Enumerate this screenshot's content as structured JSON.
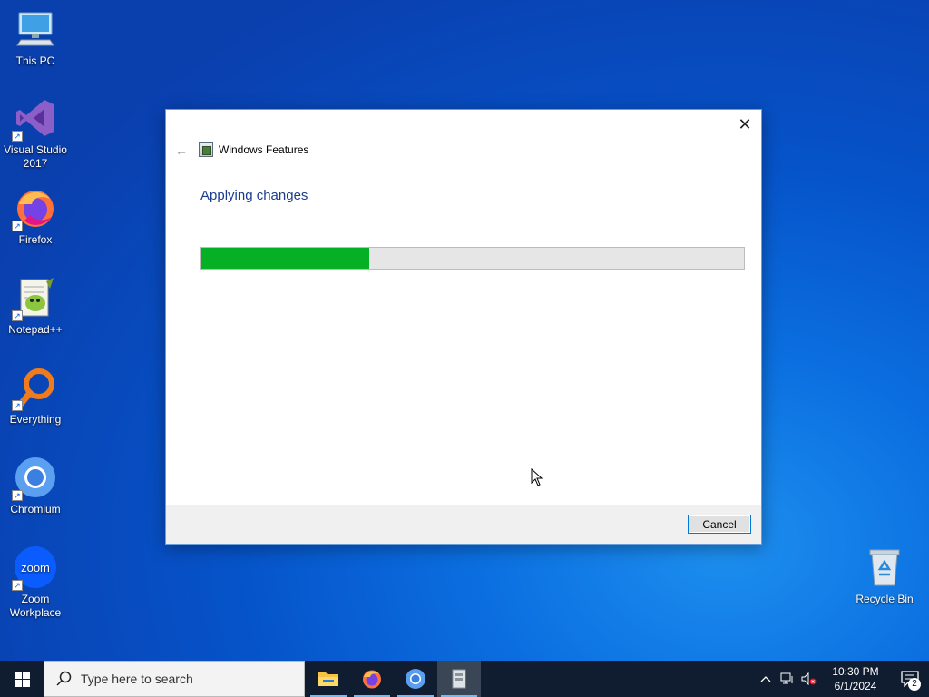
{
  "desktop": {
    "icons": [
      {
        "label": "This PC",
        "icon": "computer-icon"
      },
      {
        "label": "Visual Studio 2017",
        "icon": "visual-studio-icon"
      },
      {
        "label": "Firefox",
        "icon": "firefox-icon"
      },
      {
        "label": "Notepad++",
        "icon": "notepadpp-icon"
      },
      {
        "label": "Everything",
        "icon": "everything-search-icon"
      },
      {
        "label": "Chromium",
        "icon": "chromium-icon"
      },
      {
        "label": "Zoom Workplace",
        "icon": "zoom-icon",
        "logo_text": "zoom"
      },
      {
        "label": "Recycle Bin",
        "icon": "recycle-bin-icon"
      }
    ]
  },
  "dialog": {
    "title": "Windows Features",
    "heading": "Applying changes",
    "progress_percent": 31,
    "cancel_label": "Cancel",
    "close_glyph": "✕",
    "back_glyph": "←",
    "progress_color": "#06b025"
  },
  "taskbar": {
    "search_placeholder": "Type here to search",
    "apps": [
      {
        "name": "file-explorer",
        "icon": "folder-icon",
        "running": true,
        "active": false
      },
      {
        "name": "firefox",
        "icon": "firefox-icon",
        "running": true,
        "active": false
      },
      {
        "name": "chromium",
        "icon": "chromium-icon",
        "running": true,
        "active": false
      },
      {
        "name": "windows-features",
        "icon": "windows-features-icon",
        "running": true,
        "active": true
      }
    ],
    "time": "10:30 PM",
    "date": "6/1/2024",
    "notification_count": "2"
  }
}
